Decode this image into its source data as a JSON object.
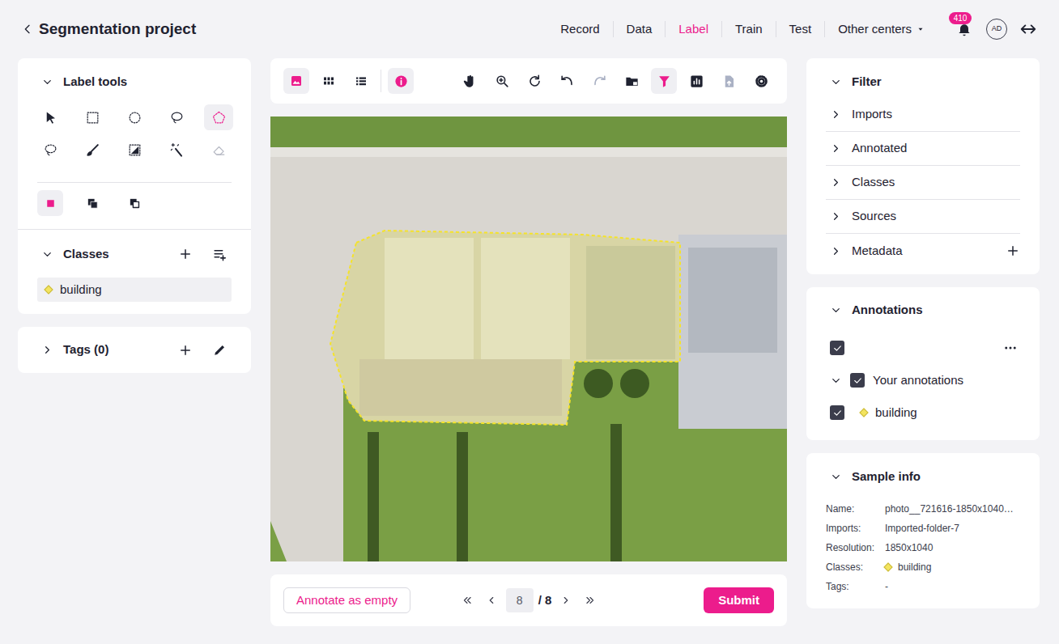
{
  "header": {
    "title": "Segmentation project",
    "nav": [
      {
        "label": "Record",
        "selected": false
      },
      {
        "label": "Data",
        "selected": false
      },
      {
        "label": "Label",
        "selected": true
      },
      {
        "label": "Train",
        "selected": false
      },
      {
        "label": "Test",
        "selected": false
      }
    ],
    "menu": {
      "label": "Other centers",
      "expanded": false
    },
    "notifications": "410",
    "avatar": "AD"
  },
  "label_tools": {
    "title": "Label tools",
    "expanded": true,
    "tools": [
      {
        "selected": false,
        "disabled": false
      },
      {
        "selected": false,
        "disabled": false
      },
      {
        "selected": false,
        "disabled": false
      },
      {
        "selected": false,
        "disabled": false
      },
      {
        "selected": true,
        "disabled": false
      },
      {
        "selected": false,
        "disabled": false
      },
      {
        "selected": false,
        "disabled": false
      },
      {
        "selected": false,
        "disabled": false
      },
      {
        "selected": false,
        "disabled": false
      },
      {
        "selected": false,
        "disabled": true
      }
    ],
    "modes": [
      {
        "selected": true
      },
      {
        "selected": false
      },
      {
        "selected": false
      }
    ]
  },
  "classes": {
    "title": "Classes",
    "expanded": true,
    "items": [
      {
        "name": "building",
        "color": "#f3e45f",
        "selected": true
      }
    ]
  },
  "tags": {
    "title": "Tags (0)",
    "expanded": false
  },
  "toolbar": {
    "views": [
      {
        "selected": true
      },
      {
        "selected": false
      },
      {
        "selected": false
      }
    ],
    "info": {
      "selected": true
    },
    "actions": [
      {
        "selected": false,
        "disabled": false
      },
      {
        "selected": false,
        "disabled": false
      },
      {
        "selected": false,
        "disabled": false
      },
      {
        "selected": false,
        "disabled": false
      },
      {
        "selected": false,
        "disabled": true
      },
      {
        "selected": false,
        "disabled": false
      },
      {
        "selected": true,
        "disabled": false
      },
      {
        "selected": false,
        "disabled": false
      },
      {
        "selected": false,
        "disabled": true
      },
      {
        "selected": false,
        "disabled": false
      }
    ]
  },
  "pager": {
    "empty_button": "Annotate as empty",
    "page": "8",
    "total": "/ 8",
    "submit": "Submit"
  },
  "filter": {
    "title": "Filter",
    "expanded": true,
    "items": [
      {
        "label": "Imports",
        "expanded": false,
        "kind": "plain"
      },
      {
        "label": "Annotated",
        "expanded": false,
        "kind": "plain"
      },
      {
        "label": "Classes",
        "expanded": false,
        "kind": "plain"
      },
      {
        "label": "Sources",
        "expanded": false,
        "kind": "plain"
      },
      {
        "label": "Metadata",
        "expanded": false,
        "kind": "addable"
      }
    ]
  },
  "annotations": {
    "title": "Annotations",
    "expanded": true,
    "all_checked": true,
    "groups": [
      {
        "label": "Your annotations",
        "expanded": true,
        "checked": true,
        "items": [
          {
            "label": "building",
            "checked": true,
            "color": "#f3e45f"
          }
        ]
      }
    ]
  },
  "sample_info": {
    "title": "Sample info",
    "expanded": true,
    "rows": [
      {
        "key": "Name:",
        "value": "photo__721616-1850x1040…",
        "kind": "text"
      },
      {
        "key": "Imports:",
        "value": "Imported-folder-7",
        "kind": "text"
      },
      {
        "key": "Resolution:",
        "value": "1850x1040",
        "kind": "text"
      },
      {
        "key": "Classes:",
        "value": "building",
        "kind": "class",
        "color": "#f3e45f"
      },
      {
        "key": "Tags:",
        "value": "-",
        "kind": "text"
      }
    ]
  }
}
